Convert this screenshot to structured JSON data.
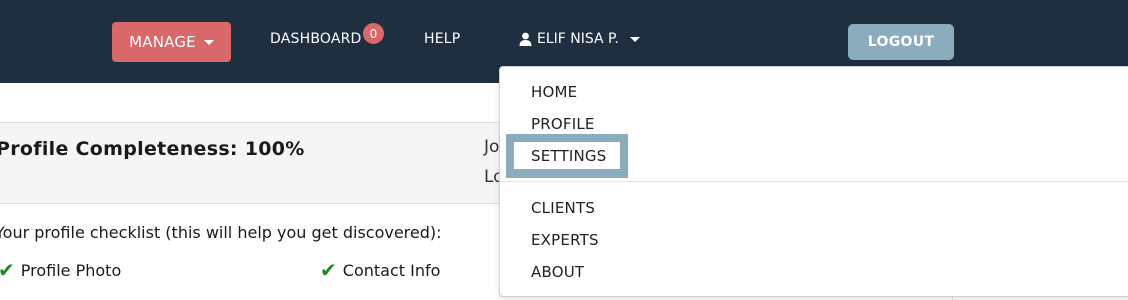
{
  "navbar": {
    "manage_label": "MANAGE",
    "dashboard_label": "DASHBOARD",
    "dashboard_badge": "0",
    "help_label": "HELP",
    "user_label": "ELIF NISA P.",
    "logout_label": "LOGOUT"
  },
  "profile": {
    "completeness": "Profile Completeness: 100%",
    "meta_line1": "Jo",
    "meta_line2": "Lo",
    "checklist_intro": "Your profile checklist (this will help you get discovered):",
    "checklist": [
      {
        "label": "Profile Photo",
        "done": true
      },
      {
        "label": "Contact Info",
        "done": true
      }
    ]
  },
  "user_menu": {
    "items": [
      "HOME",
      "PROFILE",
      "SETTINGS",
      "CLIENTS",
      "EXPERTS",
      "ABOUT"
    ],
    "focused": "SETTINGS"
  },
  "colors": {
    "navbar_bg": "#1f2f3f",
    "manage_bg": "#d9686a",
    "logout_bg": "#8aacbd",
    "check_green": "#1d8a1d"
  },
  "icons": {
    "user": "user-icon",
    "caret": "caret-down-icon",
    "check": "checkmark-icon"
  }
}
